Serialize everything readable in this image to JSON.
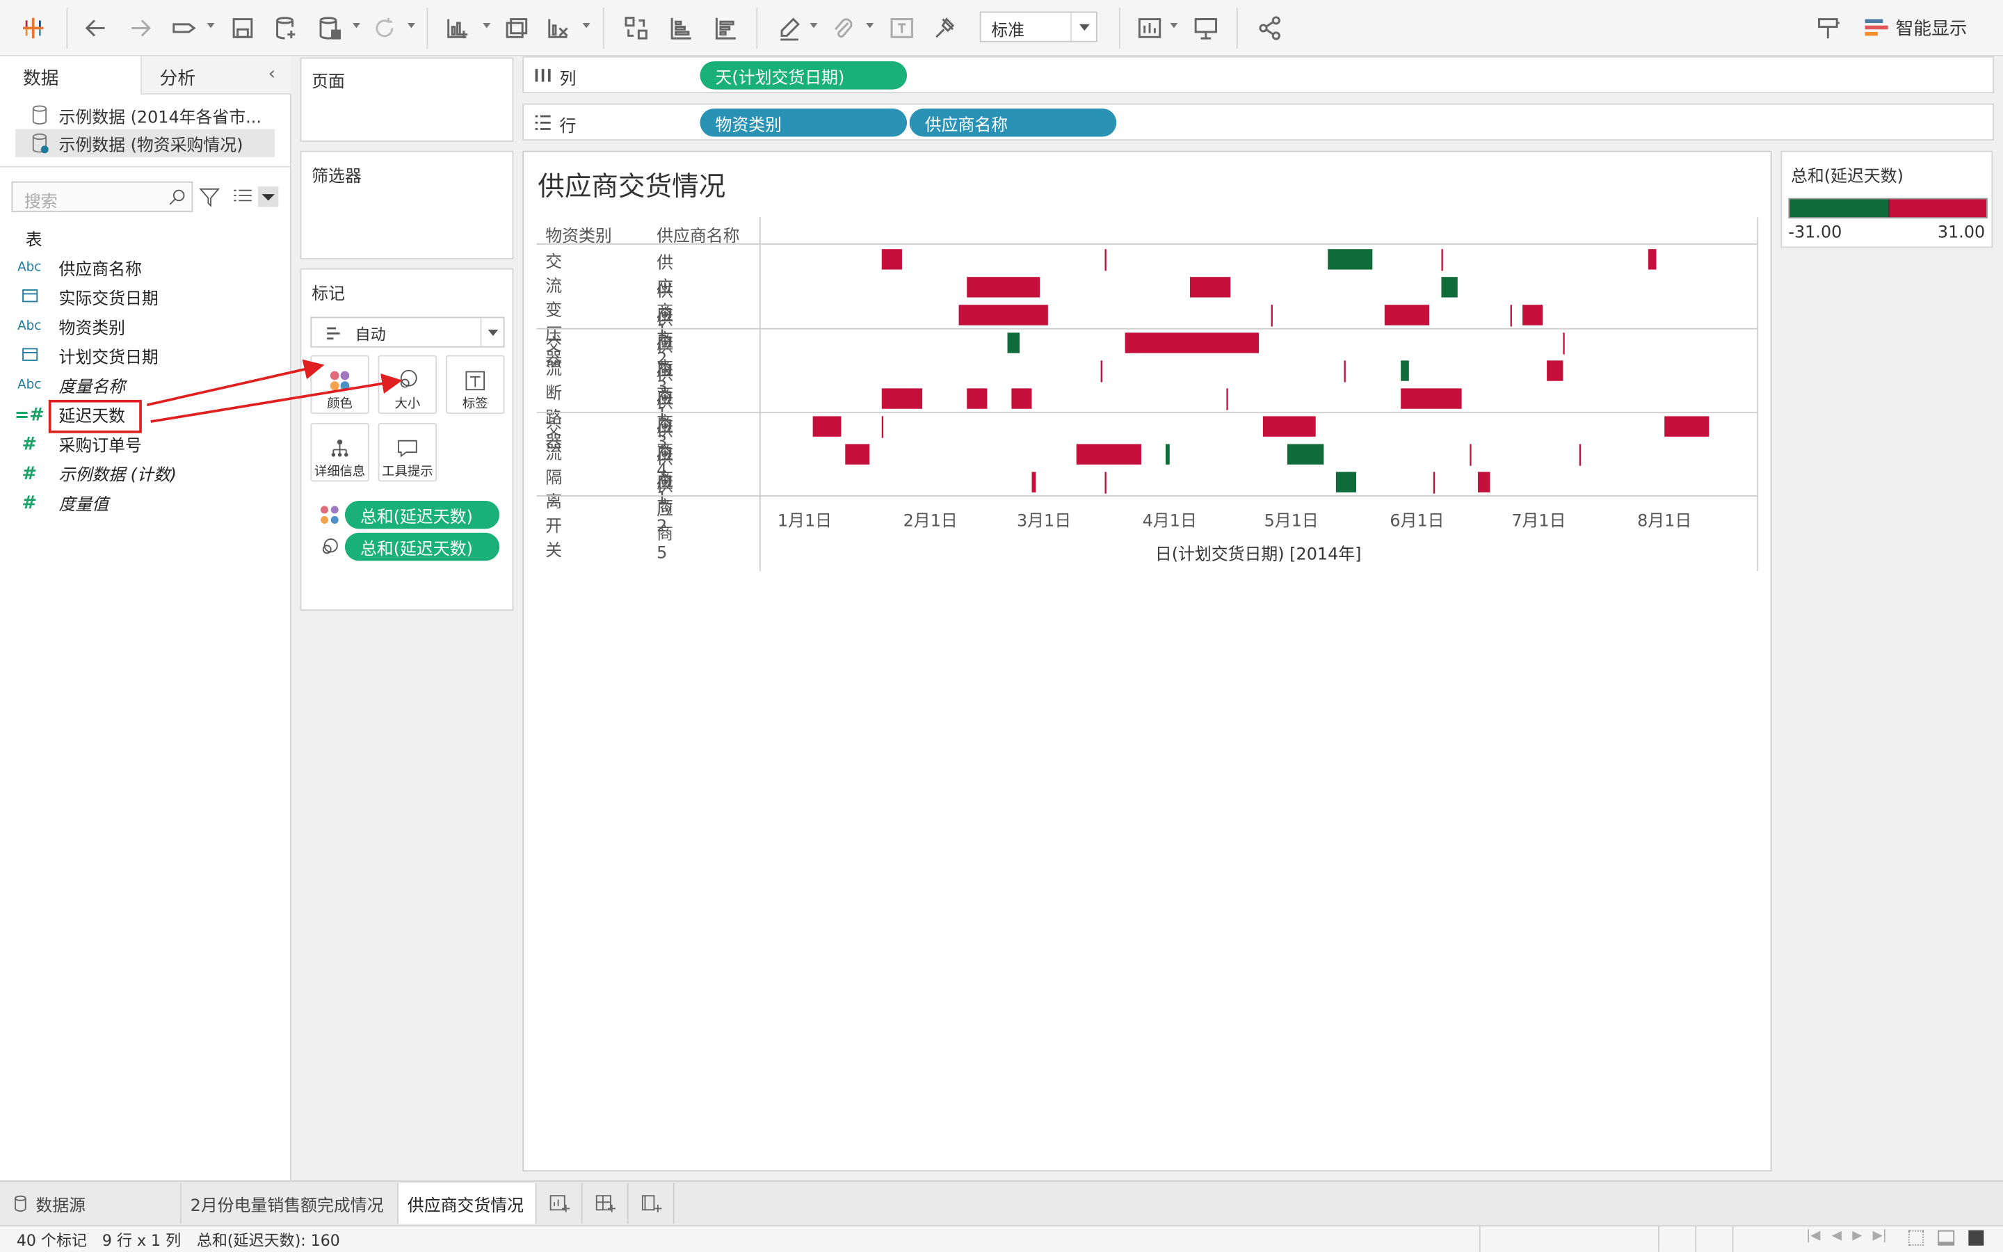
{
  "toolbar": {
    "fit_select": "标准",
    "show_me": "智能显示"
  },
  "left_panel": {
    "tabs": [
      "数据",
      "分析"
    ],
    "datasources": [
      "示例数据 (2014年各省市...",
      "示例数据 (物资采购情况)"
    ],
    "search_placeholder": "搜索",
    "table_header": "表",
    "fields": [
      {
        "type": "Abc",
        "name": "供应商名称",
        "italic": false
      },
      {
        "type": "date",
        "name": "实际交货日期",
        "italic": false
      },
      {
        "type": "Abc",
        "name": "物资类别",
        "italic": false
      },
      {
        "type": "date",
        "name": "计划交货日期",
        "italic": false
      },
      {
        "type": "Abc",
        "name": "度量名称",
        "italic": true
      },
      {
        "type": "#",
        "name": "延迟天数",
        "italic": false,
        "highlighted": true
      },
      {
        "type": "#",
        "name": "采购订单号",
        "italic": false
      },
      {
        "type": "#",
        "name": "示例数据 (计数)",
        "italic": true
      },
      {
        "type": "#",
        "name": "度量值",
        "italic": true
      }
    ]
  },
  "shelves": {
    "pages": "页面",
    "filters": "筛选器",
    "marks": "标记",
    "mark_type": "自动",
    "mark_buttons": [
      "颜色",
      "大小",
      "标签",
      "详细信息",
      "工具提示"
    ],
    "mark_pills": [
      "总和(延迟天数)",
      "总和(延迟天数)"
    ],
    "columns_label": "列",
    "rows_label": "行",
    "columns_pills": [
      "天(计划交货日期)"
    ],
    "rows_pills": [
      "物资类别",
      "供应商名称"
    ]
  },
  "legend": {
    "title": "总和(延迟天数)",
    "min": "-31.00",
    "max": "31.00",
    "neg_color": "#0f6b3a",
    "pos_color": "#c4103a"
  },
  "chart_data": {
    "type": "gantt",
    "title": "供应商交货情况",
    "header_category": "物资类别",
    "header_supplier": "供应商名称",
    "xlabel": "日(计划交货日期) [2014年]",
    "x_ticks": [
      "1月1日",
      "2月1日",
      "3月1日",
      "4月1日",
      "5月1日",
      "6月1日",
      "7月1日",
      "8月1日"
    ],
    "xlim": [
      "2013-12-21",
      "2014-08-24"
    ],
    "groups": [
      {
        "category": "交流变压器",
        "rows": [
          {
            "supplier": "供应商1",
            "bars": [
              {
                "start": "2014-01-20",
                "days": 5
              },
              {
                "start": "2014-03-16",
                "days": 0.4
              },
              {
                "start": "2014-05-10",
                "days": -11
              },
              {
                "start": "2014-06-07",
                "days": 0.4
              },
              {
                "start": "2014-07-28",
                "days": 2
              }
            ]
          },
          {
            "supplier": "供应商2",
            "bars": [
              {
                "start": "2014-02-10",
                "days": 18
              },
              {
                "start": "2014-04-06",
                "days": 10
              },
              {
                "start": "2014-06-07",
                "days": -4
              }
            ]
          },
          {
            "supplier": "供应商3",
            "bars": [
              {
                "start": "2014-02-08",
                "days": 22
              },
              {
                "start": "2014-04-26",
                "days": 0.4
              },
              {
                "start": "2014-05-24",
                "days": 11
              },
              {
                "start": "2014-06-24",
                "days": 0.4
              },
              {
                "start": "2014-06-27",
                "days": 5
              }
            ]
          }
        ]
      },
      {
        "category": "交流断路器",
        "rows": [
          {
            "supplier": "供应商1",
            "bars": [
              {
                "start": "2014-02-20",
                "days": -3
              },
              {
                "start": "2014-03-21",
                "days": 33
              },
              {
                "start": "2014-07-07",
                "days": 0.4
              }
            ]
          },
          {
            "supplier": "供应商3",
            "bars": [
              {
                "start": "2014-03-15",
                "days": 0.4
              },
              {
                "start": "2014-05-14",
                "days": 0.4
              },
              {
                "start": "2014-05-28",
                "days": -2
              },
              {
                "start": "2014-07-03",
                "days": 4
              }
            ]
          },
          {
            "supplier": "供应商4",
            "bars": [
              {
                "start": "2014-01-20",
                "days": 10
              },
              {
                "start": "2014-02-10",
                "days": 5
              },
              {
                "start": "2014-02-21",
                "days": 5
              },
              {
                "start": "2014-04-15",
                "days": 0.4
              },
              {
                "start": "2014-05-28",
                "days": 15
              }
            ]
          }
        ]
      },
      {
        "category": "交流隔离开关",
        "rows": [
          {
            "supplier": "供应商1",
            "bars": [
              {
                "start": "2014-01-03",
                "days": 7
              },
              {
                "start": "2014-01-20",
                "days": 0.4
              },
              {
                "start": "2014-04-24",
                "days": 13
              },
              {
                "start": "2014-08-01",
                "days": 11
              }
            ]
          },
          {
            "supplier": "供应商2",
            "bars": [
              {
                "start": "2014-01-11",
                "days": 6
              },
              {
                "start": "2014-03-09",
                "days": 16
              },
              {
                "start": "2014-03-31",
                "days": -1
              },
              {
                "start": "2014-04-30",
                "days": -9
              },
              {
                "start": "2014-06-14",
                "days": 0.4
              },
              {
                "start": "2014-07-11",
                "days": 0.4
              }
            ]
          },
          {
            "supplier": "供应商5",
            "bars": [
              {
                "start": "2014-02-26",
                "days": 1
              },
              {
                "start": "2014-03-16",
                "days": 0.4
              },
              {
                "start": "2014-05-12",
                "days": -5
              },
              {
                "start": "2014-06-05",
                "days": 0.4
              },
              {
                "start": "2014-06-16",
                "days": 3
              }
            ]
          }
        ]
      }
    ]
  },
  "sheet_tabs": [
    "数据源",
    "2月份电量销售额完成情况",
    "供应商交货情况"
  ],
  "status": {
    "marks": "40 个标记",
    "rows_cols": "9 行 x 1 列",
    "sum": "总和(延迟天数): 160"
  }
}
